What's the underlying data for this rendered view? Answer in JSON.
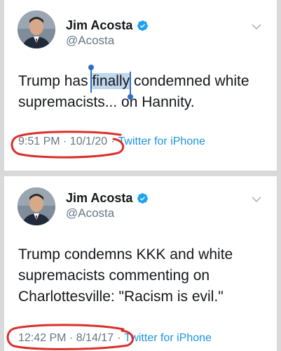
{
  "tweets": [
    {
      "name": "Jim Acosta",
      "handle": "@Acosta",
      "text_before": "Trump has ",
      "text_highlight": "finally",
      "text_after": " condemned white supremacists... on Hannity.",
      "timestamp": "9:51 PM · 10/1/20",
      "separator": "·",
      "source": "Twitter for iPhone"
    },
    {
      "name": "Jim Acosta",
      "handle": "@Acosta",
      "text": "Trump condemns KKK and white supremacists commenting on Charlottesville: \"Racism is evil.\"",
      "timestamp": "12:42 PM · 8/14/17",
      "separator": "·",
      "source": "Twitter for iPhone"
    }
  ],
  "colors": {
    "verified_badge": "#1da1f2",
    "source_link": "#1b95e0",
    "annotation_circle": "#d9302c",
    "selection": "#2f6fc0"
  },
  "icons": {
    "verified": "verified-badge-icon",
    "menu": "chevron-down-icon",
    "avatar": "profile-photo"
  }
}
